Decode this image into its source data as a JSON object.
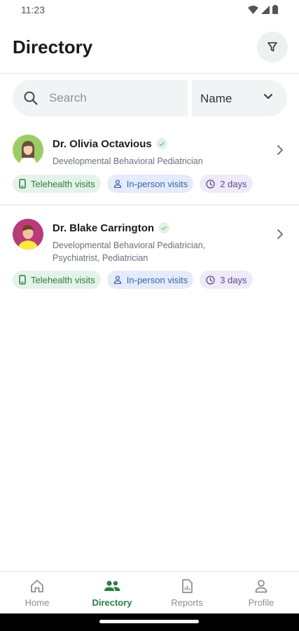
{
  "status_bar": {
    "time": "11:23"
  },
  "header": {
    "title": "Directory"
  },
  "search": {
    "placeholder": "Search"
  },
  "sort": {
    "selected": "Name"
  },
  "doctors": [
    {
      "name": "Dr. Olivia Octavious",
      "specialty": "Developmental Behavioral Pediatrician",
      "chips": {
        "telehealth": "Telehealth visits",
        "in_person": "In-person visits",
        "availability": "2 days"
      }
    },
    {
      "name": "Dr. Blake Carrington",
      "specialty": "Developmental Behavioral Pediatrician, Psychiatrist, Pediatrician",
      "chips": {
        "telehealth": "Telehealth visits",
        "in_person": "In-person visits",
        "availability": "3 days"
      }
    }
  ],
  "bottom_nav": {
    "items": [
      {
        "label": "Home",
        "icon": "home-icon"
      },
      {
        "label": "Directory",
        "icon": "people-icon",
        "active": true
      },
      {
        "label": "Reports",
        "icon": "report-icon"
      },
      {
        "label": "Profile",
        "icon": "person-icon"
      }
    ]
  },
  "colors": {
    "accent_green": "#2e7d3e",
    "telehealth_chip_bg": "#e4f3e8",
    "in_person_chip_bg": "#e4ecfa",
    "availability_chip_bg": "#efeaf8"
  }
}
